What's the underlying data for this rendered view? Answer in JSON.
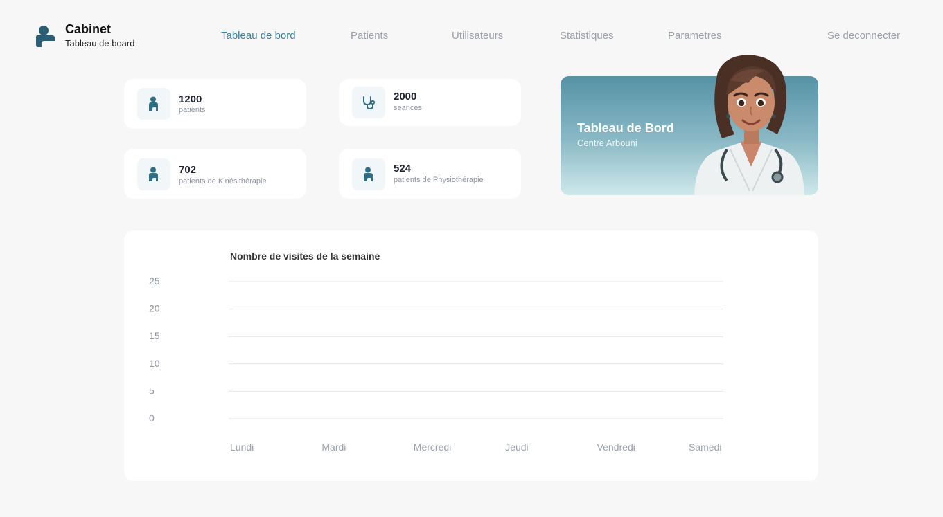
{
  "brand": {
    "name": "Cabinet",
    "subtitle": "Tableau de board"
  },
  "nav": [
    {
      "label": "Tableau de bord",
      "active": true
    },
    {
      "label": "Patients",
      "active": false
    },
    {
      "label": "Utilisateurs",
      "active": false
    },
    {
      "label": "Statistiques",
      "active": false
    },
    {
      "label": "Parametres",
      "active": false
    }
  ],
  "logout": "Se deconnecter",
  "stats": [
    {
      "value": "1200",
      "label": "patients",
      "icon": "patient-icon"
    },
    {
      "value": "2000",
      "label": "seances",
      "icon": "stethoscope-icon"
    },
    {
      "value": "702",
      "label": "patients de Kinésithérapie",
      "icon": "patient-icon"
    },
    {
      "value": "524",
      "label": "patients de Physiothérapie",
      "icon": "patient-icon"
    }
  ],
  "hero": {
    "title": "Tableau de Bord",
    "subtitle": "Centre Arbouni"
  },
  "colors": {
    "accent": "#3c7f94",
    "icon": "#2f6f86",
    "muted": "#9aa0ab"
  },
  "chart_data": {
    "type": "line",
    "title": "Nombre de visites de la semaine",
    "categories": [
      "Lundi",
      "Mardi",
      "Mercredi",
      "Jeudi",
      "Vendredi",
      "Samedi"
    ],
    "yticks": [
      25,
      20,
      15,
      10,
      5,
      0
    ],
    "ylim": [
      0,
      25
    ],
    "grid": true,
    "series": []
  }
}
